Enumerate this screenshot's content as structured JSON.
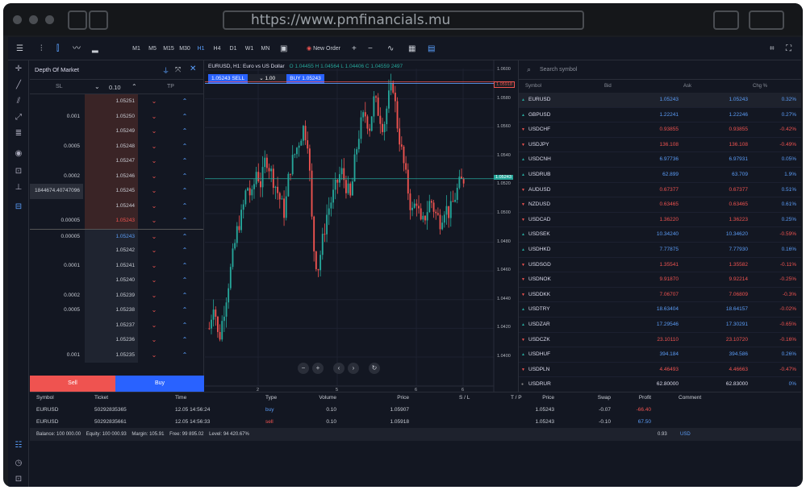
{
  "browser": {
    "url": "https://www.pmfinancials.mu"
  },
  "toolbar": {
    "timeframes": [
      "M1",
      "M5",
      "M15",
      "M30",
      "H1",
      "H4",
      "D1",
      "W1",
      "MN"
    ],
    "active_timeframe": "H1",
    "new_order": "New Order",
    "plus": "+",
    "minus": "−"
  },
  "dom": {
    "title": "Depth Of Market",
    "sl": "SL",
    "tp": "TP",
    "volume": "0.10",
    "rows": [
      {
        "vol": "",
        "price": "1.05251",
        "side": "ask"
      },
      {
        "vol": "0.001",
        "price": "1.05250",
        "side": "ask"
      },
      {
        "vol": "",
        "price": "1.05249",
        "side": "ask"
      },
      {
        "vol": "0.0005",
        "price": "1.05248",
        "side": "ask"
      },
      {
        "vol": "",
        "price": "1.05247",
        "side": "ask"
      },
      {
        "vol": "0.0002",
        "price": "1.05246",
        "side": "ask"
      },
      {
        "vol": "1844674.40747096",
        "price": "1.05245",
        "side": "ask"
      },
      {
        "vol": "",
        "price": "1.05244",
        "side": "ask"
      },
      {
        "vol": "0.00005",
        "price": "1.05243",
        "side": "ask",
        "hl": "red"
      },
      {
        "vol": "0.00005",
        "price": "1.05243",
        "side": "bid",
        "hl": "blue"
      },
      {
        "vol": "",
        "price": "1.05242",
        "side": "bid"
      },
      {
        "vol": "0.0001",
        "price": "1.05241",
        "side": "bid"
      },
      {
        "vol": "",
        "price": "1.05240",
        "side": "bid"
      },
      {
        "vol": "0.0002",
        "price": "1.05239",
        "side": "bid"
      },
      {
        "vol": "0.0005",
        "price": "1.05238",
        "side": "bid"
      },
      {
        "vol": "",
        "price": "1.05237",
        "side": "bid"
      },
      {
        "vol": "",
        "price": "1.05236",
        "side": "bid"
      },
      {
        "vol": "0.001",
        "price": "1.05235",
        "side": "bid"
      }
    ],
    "sell": "Sell",
    "buy": "Buy"
  },
  "chart": {
    "title": "EURUSD, H1: Euro vs US Dollar",
    "ohlc": "O 1.04455 H 1.04564 L 1.04406 C 1.04559 2497",
    "sell_price": "1.05243",
    "sell_label": "SELL",
    "lot": "1.00",
    "buy_label": "BUY",
    "buy_price": "1.05243",
    "price_labels": [
      "1.0600",
      "1.0580",
      "1.0560",
      "1.0540",
      "1.0520",
      "1.0500",
      "1.0480",
      "1.0460",
      "1.0440",
      "1.0420",
      "1.0400"
    ],
    "x_labels": [
      "2",
      "5",
      "6",
      "6"
    ],
    "last_price": "1.05243",
    "order_price": "1.05918"
  },
  "market_watch": {
    "search_placeholder": "Search symbol",
    "headers": [
      "Symbol",
      "Bid",
      "Ask",
      "Chg %"
    ],
    "rows": [
      {
        "sym": "EURUSD",
        "bid": "1.05243",
        "ask": "1.05243",
        "chg": "0.32%",
        "dir": "up"
      },
      {
        "sym": "GBPUSD",
        "bid": "1.22241",
        "ask": "1.22246",
        "chg": "0.27%",
        "dir": "up"
      },
      {
        "sym": "USDCHF",
        "bid": "0.93855",
        "ask": "0.93855",
        "chg": "-0.42%",
        "dir": "down"
      },
      {
        "sym": "USDJPY",
        "bid": "136.108",
        "ask": "136.108",
        "chg": "-0.49%",
        "dir": "down"
      },
      {
        "sym": "USDCNH",
        "bid": "6.97736",
        "ask": "6.97931",
        "chg": "0.05%",
        "dir": "up"
      },
      {
        "sym": "USDRUB",
        "bid": "62.899",
        "ask": "63.709",
        "chg": "1.9%",
        "dir": "up"
      },
      {
        "sym": "AUDUSD",
        "bid": "0.67377",
        "ask": "0.67377",
        "chg": "0.51%",
        "dir": "down"
      },
      {
        "sym": "NZDUSD",
        "bid": "0.63465",
        "ask": "0.63465",
        "chg": "0.61%",
        "dir": "down"
      },
      {
        "sym": "USDCAD",
        "bid": "1.36220",
        "ask": "1.36223",
        "chg": "0.25%",
        "dir": "down"
      },
      {
        "sym": "USDSEK",
        "bid": "10.34240",
        "ask": "10.34620",
        "chg": "-0.59%",
        "dir": "up"
      },
      {
        "sym": "USDHKD",
        "bid": "7.77875",
        "ask": "7.77930",
        "chg": "0.16%",
        "dir": "up"
      },
      {
        "sym": "USDSGD",
        "bid": "1.35541",
        "ask": "1.35582",
        "chg": "-0.11%",
        "dir": "down"
      },
      {
        "sym": "USDNOK",
        "bid": "9.91870",
        "ask": "9.92214",
        "chg": "-0.25%",
        "dir": "down"
      },
      {
        "sym": "USDDKK",
        "bid": "7.06707",
        "ask": "7.06809",
        "chg": "-0.3%",
        "dir": "down"
      },
      {
        "sym": "USDTRY",
        "bid": "18.63404",
        "ask": "18.64157",
        "chg": "-0.02%",
        "dir": "up"
      },
      {
        "sym": "USDZAR",
        "bid": "17.29546",
        "ask": "17.30291",
        "chg": "-0.65%",
        "dir": "up"
      },
      {
        "sym": "USDCZK",
        "bid": "23.10110",
        "ask": "23.10720",
        "chg": "-0.16%",
        "dir": "down"
      },
      {
        "sym": "USDHUF",
        "bid": "394.184",
        "ask": "394.586",
        "chg": "0.26%",
        "dir": "up"
      },
      {
        "sym": "USDPLN",
        "bid": "4.46493",
        "ask": "4.46663",
        "chg": "-0.47%",
        "dir": "down"
      },
      {
        "sym": "USDRUR",
        "bid": "62.80000",
        "ask": "62.83000",
        "chg": "0%",
        "dir": "none"
      }
    ]
  },
  "positions": {
    "headers": [
      "Symbol",
      "Ticket",
      "Time",
      "Type",
      "Volume",
      "Price",
      "S / L",
      "T / P",
      "Price",
      "Swap",
      "Profit",
      "Comment"
    ],
    "rows": [
      {
        "sym": "EURUSD",
        "ticket": "50292835365",
        "time": "12.05 14:56:24",
        "type": "buy",
        "vol": "0.10",
        "price": "1.05907",
        "cur": "1.05243",
        "swap": "-0.07",
        "profit": "-66.40"
      },
      {
        "sym": "EURUSD",
        "ticket": "50292835661",
        "time": "12.05 14:56:33",
        "type": "sell",
        "vol": "0.10",
        "price": "1.05918",
        "cur": "1.05243",
        "swap": "-0.10",
        "profit": "67.50"
      }
    ],
    "status": "Balance: 100 000.00    Equity: 100 000.93    Margin: 105.91    Free: 99 895.02    Level: 94 420.67%",
    "total": "0.93",
    "currency": "USD"
  }
}
